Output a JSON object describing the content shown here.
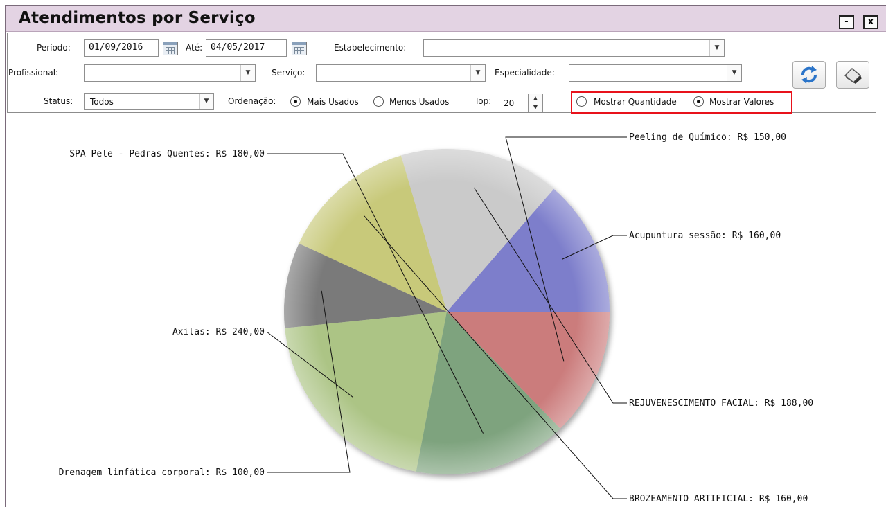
{
  "window": {
    "title": "Atendimentos por Serviço",
    "minimize_label": "-",
    "close_label": "x"
  },
  "filters": {
    "periodo_label": "Período:",
    "periodo_value": "01/09/2016",
    "ate_label": "Até:",
    "ate_value": "04/05/2017",
    "estabelecimento_label": "Estabelecimento:",
    "estabelecimento_value": "",
    "profissional_label": "Profissional:",
    "profissional_value": "",
    "servico_label": "Serviço:",
    "servico_value": "",
    "especialidade_label": "Especialidade:",
    "especialidade_value": "",
    "status_label": "Status:",
    "status_value": "Todos",
    "ordenacao_label": "Ordenação:",
    "ordenacao_options": [
      "Mais Usados",
      "Menos Usados"
    ],
    "ordenacao_selected": "Mais Usados",
    "top_label": "Top:",
    "top_value": "20",
    "display_options": [
      "Mostrar Quantidade",
      "Mostrar Valores"
    ],
    "display_selected": "Mostrar Valores"
  },
  "toolbar": {
    "refresh_icon": "refresh-icon",
    "clear_icon": "eraser-icon"
  },
  "chart_data": {
    "type": "pie",
    "title": "",
    "categories": [
      "Acupuntura sessão",
      "REJUVENESCIMENTO FACIAL",
      "BROZEAMENTO ARTIFICIAL",
      "Drenagem linfática corporal",
      "Axilas",
      "SPA Pele - Pedras Quentes",
      "Peeling de Químico"
    ],
    "values": [
      160,
      188,
      160,
      100,
      240,
      180,
      150
    ],
    "labels": [
      "Acupuntura sessão: R$ 160,00",
      "REJUVENESCIMENTO FACIAL: R$ 188,00",
      "BROZEAMENTO ARTIFICIAL: R$ 160,00",
      "Drenagem linfática corporal: R$ 100,00",
      "Axilas: R$ 240,00",
      "SPA Pele - Pedras Quentes: R$ 180,00",
      "Peeling de Químico: R$ 150,00"
    ],
    "colors": [
      "#7d7ecb",
      "#cacaca",
      "#c8c97a",
      "#7a7a7a",
      "#acc485",
      "#7ea37e",
      "#cb7b7b"
    ],
    "legend": "none"
  }
}
